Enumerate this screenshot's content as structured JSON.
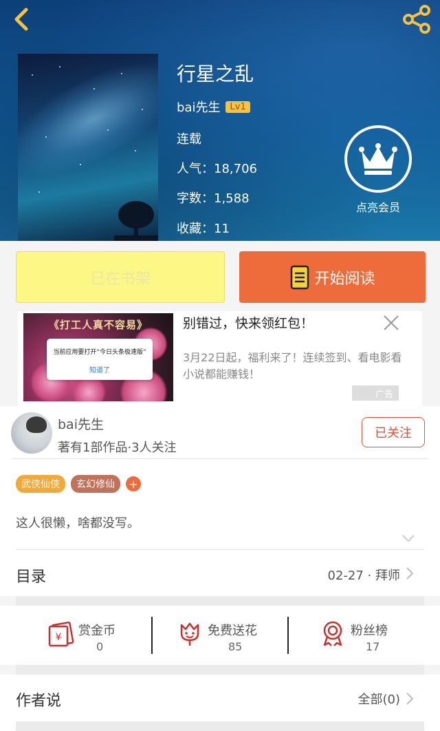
{
  "book": {
    "title": "行星之乱",
    "author": "bai先生",
    "author_level": "Lv1",
    "status": "连载",
    "popularity": "人气：18,706",
    "word_count": "字数：1,588",
    "favorites": "收藏：11"
  },
  "vip": {
    "label": "点亮会员"
  },
  "actions": {
    "shelf_label": "已在书架",
    "read_label": "开始阅读"
  },
  "ad": {
    "image_banner": "《打工人真不容易》",
    "dialog_text": "当前应用要打开“今日头条极速版”",
    "dialog_button": "知道了",
    "title": "别错过，快来领红包！",
    "description": "3月22日起，福利来了！连续签到、看电影看小说都能赚钱！",
    "tag": "广告"
  },
  "author_section": {
    "name": "bai先生",
    "meta": "著有1部作品·3人关注",
    "follow_label": "已关注",
    "tags": [
      {
        "label": "武侠仙侠",
        "color": "#f2a93b"
      },
      {
        "label": "玄幻修仙",
        "color": "#c0735a"
      }
    ],
    "tag_add": "+",
    "intro": "这人很懒，啥都没写。"
  },
  "catalog": {
    "title": "目录",
    "latest": "02-27 · 拜师"
  },
  "stats": [
    {
      "label": "赏金币",
      "value": "0",
      "icon": "reward-coin-icon"
    },
    {
      "label": "免费送花",
      "value": "85",
      "icon": "flower-icon"
    },
    {
      "label": "粉丝榜",
      "value": "17",
      "icon": "medal-icon"
    }
  ],
  "author_says": {
    "title": "作者说",
    "all_label": "全部(0)"
  },
  "colors": {
    "accent": "#ee6b3b",
    "follow": "#d9543a",
    "shelf": "#fdf785",
    "header": "#0f5a95"
  }
}
